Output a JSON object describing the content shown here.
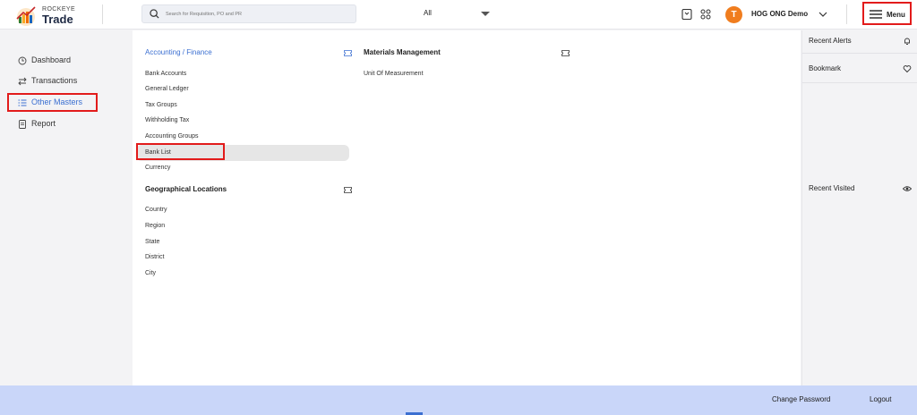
{
  "brand": {
    "top": "ROCKEYE",
    "name": "Trade"
  },
  "search": {
    "placeholder": "Search for Requisition, PO and PR",
    "filter_value": "All"
  },
  "user": {
    "avatar_letter": "T",
    "name": "HOG ONG Demo"
  },
  "menu": {
    "label": "Menu"
  },
  "sidebar": {
    "items": [
      {
        "label": "Dashboard",
        "icon": "clock-icon"
      },
      {
        "label": "Transactions",
        "icon": "swap-icon"
      },
      {
        "label": "Other Masters",
        "icon": "list-icon",
        "active": true
      },
      {
        "label": "Report",
        "icon": "document-icon"
      }
    ]
  },
  "sections": {
    "accounting": {
      "title": "Accounting / Finance",
      "items": [
        "Bank Accounts",
        "General Ledger",
        "Tax Groups",
        "Withholding Tax",
        "Accounting Groups",
        "Bank List",
        "Currency"
      ]
    },
    "geo": {
      "title": "Geographical Locations",
      "items": [
        "Country",
        "Region",
        "State",
        "District",
        "City"
      ]
    },
    "materials": {
      "title": "Materials Management",
      "items": [
        "Unit Of Measurement"
      ]
    }
  },
  "right_panel": {
    "recent_alerts": "Recent Alerts",
    "bookmark": "Bookmark",
    "recent_visited": "Recent Visited"
  },
  "footer": {
    "change_password": "Change Password",
    "logout": "Logout"
  },
  "colors": {
    "accent": "#3b6fd1",
    "highlight": "#e21b1b",
    "avatar": "#f07d1e",
    "footer": "#c9d6f9"
  }
}
